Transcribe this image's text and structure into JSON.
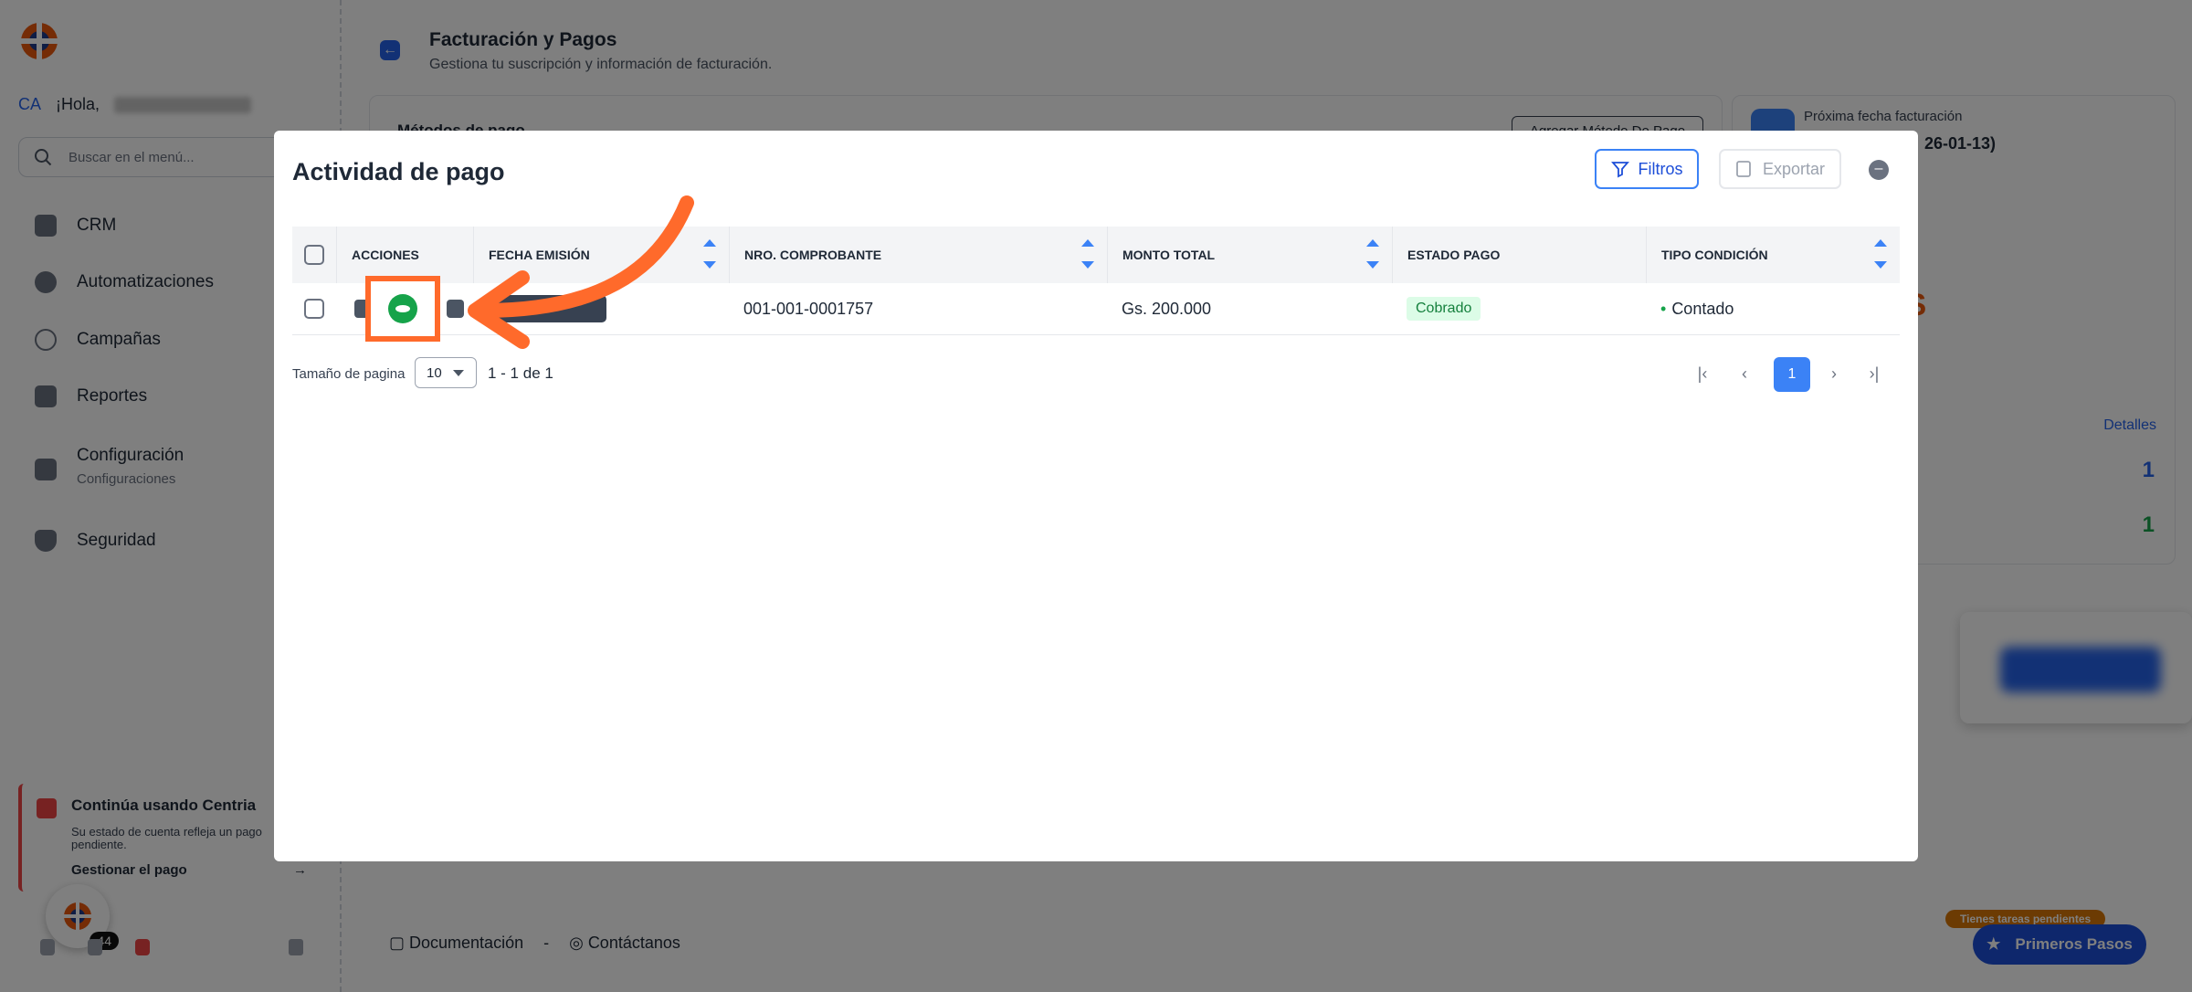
{
  "sidebar": {
    "user_initials": "CA",
    "greeting": "¡Hola,",
    "search_placeholder": "Buscar en el menú...",
    "items": [
      {
        "label": "CRM",
        "icon": "crm-icon"
      },
      {
        "label": "Automatizaciones",
        "icon": "automation-icon"
      },
      {
        "label": "Campañas",
        "icon": "broadcast-icon"
      },
      {
        "label": "Reportes",
        "icon": "report-icon"
      },
      {
        "label": "Configuración",
        "sublabel": "Configuraciones",
        "icon": "settings-icon"
      },
      {
        "label": "Seguridad",
        "icon": "shield-icon"
      }
    ],
    "notice": {
      "title": "Continúa usando Centria",
      "description": "Su estado de cuenta refleja un pago pendiente.",
      "link": "Gestionar el pago"
    },
    "fab_badge": "44"
  },
  "page": {
    "title": "Facturación y Pagos",
    "subtitle": "Gestiona tu suscripción y información de facturación.",
    "payment_methods_title": "Métodos de pago",
    "add_method_button": "Agregar Método De Pago",
    "next_billing_label": "Próxima fecha facturación",
    "next_billing_value": "26-01-13)",
    "status_fragment": "IS",
    "details_link": "Detalles",
    "stat_one": "1",
    "stat_two": "1",
    "footer_docs": "Documentación",
    "footer_separator": "-",
    "footer_contact": "Contáctanos",
    "pending_tasks": "Tienes tareas pendientes",
    "first_steps": "Primeros Pasos"
  },
  "modal": {
    "title": "Actividad de pago",
    "filter_button": "Filtros",
    "export_button": "Exportar",
    "columns": [
      "ACCIONES",
      "FECHA EMISIÓN",
      "NRO. COMPROBANTE",
      "MONTO TOTAL",
      "ESTADO PAGO",
      "TIPO CONDICIÓN"
    ],
    "rows": [
      {
        "comprobante": "001-001-0001757",
        "monto": "Gs. 200.000",
        "estado": "Cobrado",
        "condicion": "Contado"
      }
    ],
    "pager": {
      "label": "Tamaño de pagina",
      "size": "10",
      "range": "1 - 1 de 1",
      "current_page": "1"
    }
  },
  "colors": {
    "accent": "#3b82f6",
    "annotation": "#ff6a2b",
    "success": "#16a34a",
    "warning": "#ea580c"
  }
}
